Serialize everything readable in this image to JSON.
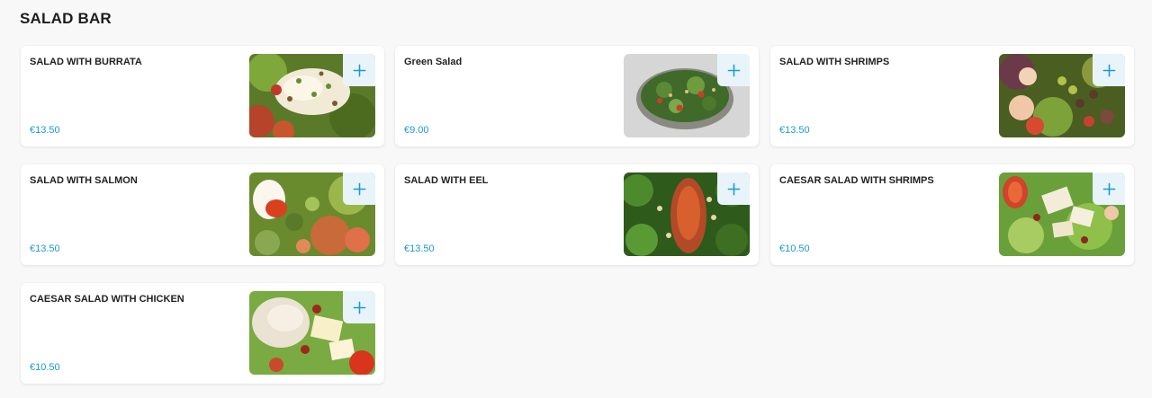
{
  "section": {
    "title": "SALAD BAR"
  },
  "colors": {
    "accent": "#1a9ad6",
    "add_button_bg": "#e8f4fa",
    "background": "#f8f8f8"
  },
  "items": [
    {
      "name": "SALAD WITH BURRATA",
      "price": "€13.50",
      "image": "burrata-salad-photo",
      "icon": "plus-icon"
    },
    {
      "name": "Green Salad",
      "price": "€9.00",
      "image": "green-salad-bowl-photo",
      "icon": "plus-icon"
    },
    {
      "name": "SALAD WITH SHRIMPS",
      "price": "€13.50",
      "image": "shrimp-salad-photo",
      "icon": "plus-icon"
    },
    {
      "name": "SALAD WITH SALMON",
      "price": "€13.50",
      "image": "salmon-salad-photo",
      "icon": "plus-icon"
    },
    {
      "name": "SALAD WITH EEL",
      "price": "€13.50",
      "image": "eel-salad-photo",
      "icon": "plus-icon"
    },
    {
      "name": "CAESAR SALAD WITH SHRIMPS",
      "price": "€10.50",
      "image": "caesar-shrimp-salad-photo",
      "icon": "plus-icon"
    },
    {
      "name": "CAESAR SALAD WITH CHICKEN",
      "price": "€10.50",
      "image": "caesar-chicken-salad-photo",
      "icon": "plus-icon"
    }
  ]
}
